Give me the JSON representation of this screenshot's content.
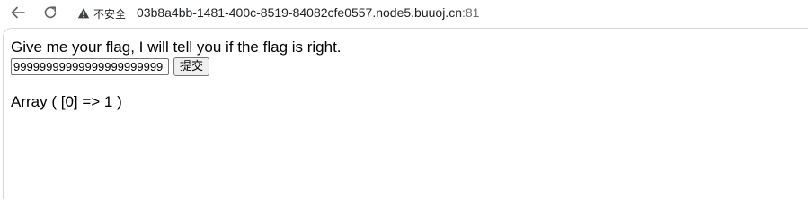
{
  "browser": {
    "security_label": "不安全",
    "url_host": "03b8a4bb-1481-400c-8519-84082cfe0557.node5.buuoj.cn",
    "url_port": ":81"
  },
  "page": {
    "prompt": "Give me your flag, I will tell you if the flag is right.",
    "flag_input_value": "99999999999999999999999",
    "submit_label": "提交",
    "result": "Array ( [0] => 1 )"
  }
}
